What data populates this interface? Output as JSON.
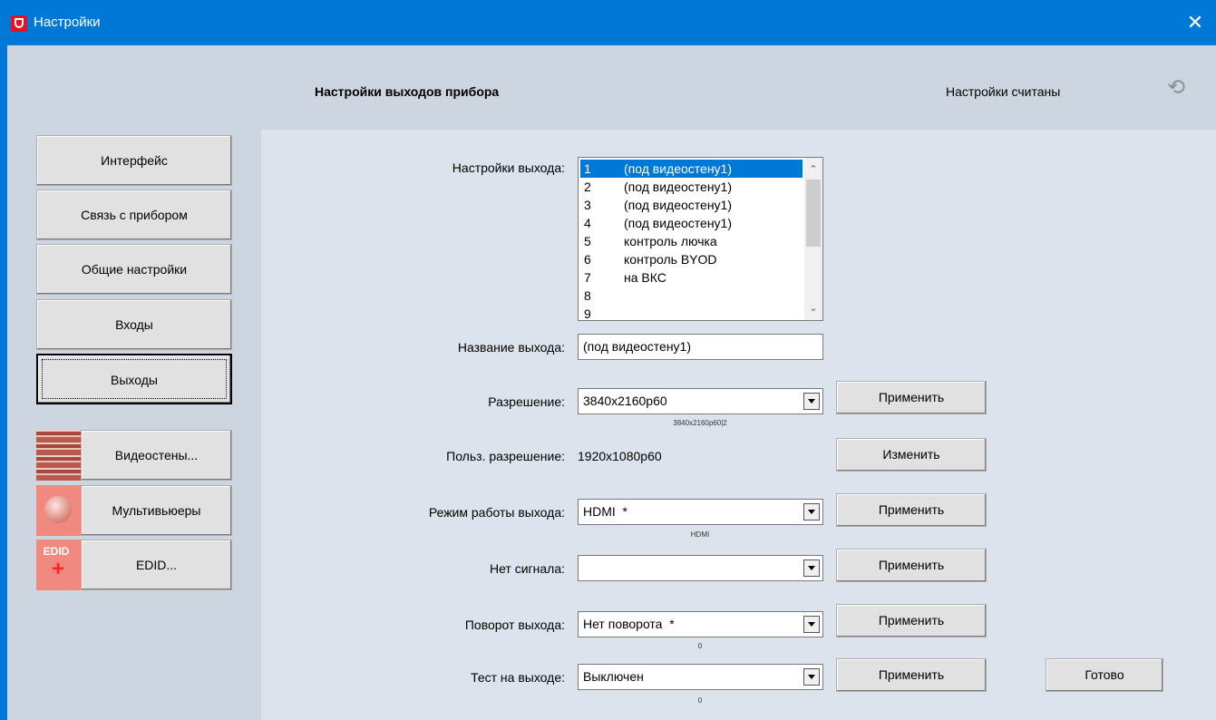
{
  "window": {
    "title": "Настройки",
    "close_glyph": "✕",
    "icon": "app-shield-icon"
  },
  "header": {
    "title": "Настройки выходов прибора",
    "status": "Настройки считаны",
    "refresh_icon": "refresh-icon"
  },
  "nav": {
    "items": [
      {
        "label": "Интерфейс"
      },
      {
        "label": "Связь с прибором"
      },
      {
        "label": "Общие настройки"
      },
      {
        "label": "Входы"
      },
      {
        "label": "Выходы",
        "active": true
      }
    ],
    "icon_items": [
      {
        "label": "Видеостены...",
        "icon": "videowall-icon"
      },
      {
        "label": "Мультивьюеры",
        "icon": "multiviewer-icon"
      },
      {
        "label": "EDID...",
        "icon": "edid-icon",
        "icon_text": "EDID",
        "icon_plus": "+"
      }
    ]
  },
  "form": {
    "output_settings": {
      "label": "Настройки выхода:",
      "selected_index": 0,
      "items": [
        {
          "num": "1",
          "text": "(под видеостену1)"
        },
        {
          "num": "2",
          "text": "(под видеостену1)"
        },
        {
          "num": "3",
          "text": "(под видеостену1)"
        },
        {
          "num": "4",
          "text": "(под видеостену1)"
        },
        {
          "num": "5",
          "text": "контроль лючка"
        },
        {
          "num": "6",
          "text": "контроль BYOD"
        },
        {
          "num": "7",
          "text": "на ВКС"
        },
        {
          "num": "8",
          "text": ""
        },
        {
          "num": "9",
          "text": ""
        }
      ]
    },
    "output_name": {
      "label": "Название выхода:",
      "value": "(под видеостену1)"
    },
    "resolution": {
      "label": "Разрешение:",
      "value": "3840x2160p60",
      "hint": "3840x2160p60|2",
      "button": "Применить"
    },
    "custom_resolution": {
      "label": "Польз. разрешение:",
      "value": "1920x1080p60",
      "button": "Изменить"
    },
    "output_mode": {
      "label": "Режим работы выхода:",
      "value": "HDMI  *",
      "hint": "HDMI",
      "button": "Применить"
    },
    "no_signal": {
      "label": "Нет сигнала:",
      "value": "",
      "button": "Применить"
    },
    "rotation": {
      "label": "Поворот выхода:",
      "value": "Нет поворота  *",
      "hint": "0",
      "button": "Применить"
    },
    "test": {
      "label": "Тест на выходе:",
      "value": "Выключен",
      "hint": "0",
      "button": "Применить"
    }
  },
  "done_button": "Готово"
}
